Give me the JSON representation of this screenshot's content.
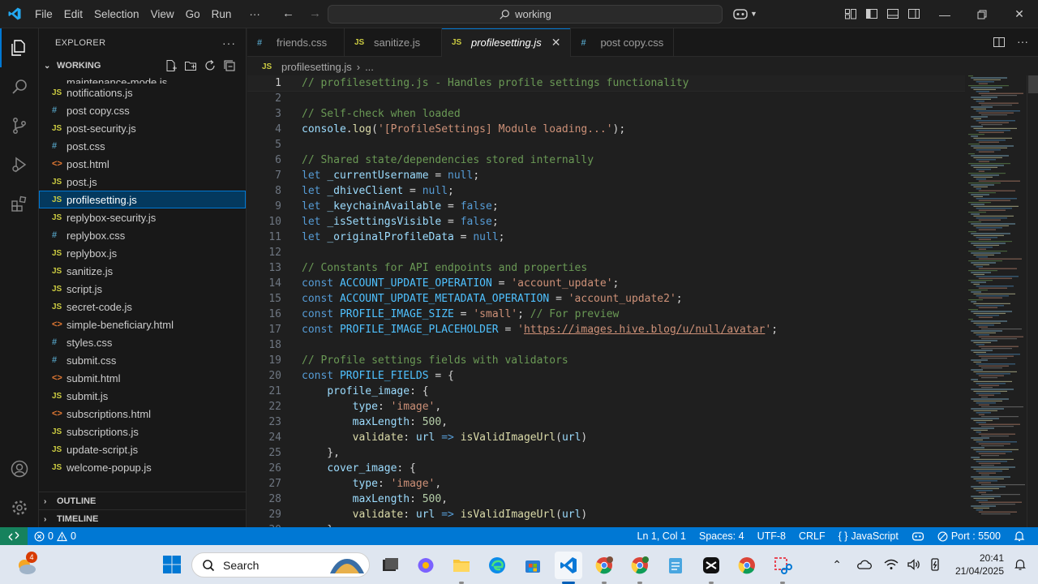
{
  "menu": [
    "File",
    "Edit",
    "Selection",
    "View",
    "Go",
    "Run",
    "···"
  ],
  "command_center": {
    "text": "working"
  },
  "sidebar": {
    "title": "EXPLORER",
    "folder": "WORKING",
    "partial_item": "maintenance-mode.js",
    "files": [
      {
        "name": "notifications.js",
        "type": "js"
      },
      {
        "name": "post copy.css",
        "type": "css"
      },
      {
        "name": "post-security.js",
        "type": "js"
      },
      {
        "name": "post.css",
        "type": "css"
      },
      {
        "name": "post.html",
        "type": "html"
      },
      {
        "name": "post.js",
        "type": "js"
      },
      {
        "name": "profilesetting.js",
        "type": "js",
        "selected": true
      },
      {
        "name": "replybox-security.js",
        "type": "js"
      },
      {
        "name": "replybox.css",
        "type": "css"
      },
      {
        "name": "replybox.js",
        "type": "js"
      },
      {
        "name": "sanitize.js",
        "type": "js"
      },
      {
        "name": "script.js",
        "type": "js"
      },
      {
        "name": "secret-code.js",
        "type": "js"
      },
      {
        "name": "simple-beneficiary.html",
        "type": "html"
      },
      {
        "name": "styles.css",
        "type": "css"
      },
      {
        "name": "submit.css",
        "type": "css"
      },
      {
        "name": "submit.html",
        "type": "html"
      },
      {
        "name": "submit.js",
        "type": "js"
      },
      {
        "name": "subscriptions.html",
        "type": "html"
      },
      {
        "name": "subscriptions.js",
        "type": "js"
      },
      {
        "name": "update-script.js",
        "type": "js"
      },
      {
        "name": "welcome-popup.js",
        "type": "js"
      }
    ],
    "outline_label": "OUTLINE",
    "timeline_label": "TIMELINE"
  },
  "icon_glyphs": {
    "js": "JS",
    "css": "#",
    "html": "<>"
  },
  "tabs": [
    {
      "label": "friends.css",
      "type": "css"
    },
    {
      "label": "sanitize.js",
      "type": "js"
    },
    {
      "label": "profilesetting.js",
      "type": "js",
      "active": true
    },
    {
      "label": "post copy.css",
      "type": "css"
    }
  ],
  "breadcrumb": {
    "file": "profilesetting.js",
    "rest": "..."
  },
  "editor": {
    "lines": [
      [
        [
          "c",
          "// profilesetting.js - Handles profile settings functionality"
        ]
      ],
      [],
      [
        [
          "c",
          "// Self-check when loaded"
        ]
      ],
      [
        [
          "v",
          "console"
        ],
        [
          "p",
          "."
        ],
        [
          "f",
          "log"
        ],
        [
          "p",
          "("
        ],
        [
          "s",
          "'[ProfileSettings] Module loading...'"
        ],
        [
          "p",
          ");"
        ]
      ],
      [],
      [
        [
          "c",
          "// Shared state/dependencies stored internally"
        ]
      ],
      [
        [
          "k",
          "let"
        ],
        [
          "p",
          " "
        ],
        [
          "v",
          "_currentUsername"
        ],
        [
          "p",
          " = "
        ],
        [
          "k",
          "null"
        ],
        [
          "p",
          ";"
        ]
      ],
      [
        [
          "k",
          "let"
        ],
        [
          "p",
          " "
        ],
        [
          "v",
          "_dhiveClient"
        ],
        [
          "p",
          " = "
        ],
        [
          "k",
          "null"
        ],
        [
          "p",
          ";"
        ]
      ],
      [
        [
          "k",
          "let"
        ],
        [
          "p",
          " "
        ],
        [
          "v",
          "_keychainAvailable"
        ],
        [
          "p",
          " = "
        ],
        [
          "k",
          "false"
        ],
        [
          "p",
          ";"
        ]
      ],
      [
        [
          "k",
          "let"
        ],
        [
          "p",
          " "
        ],
        [
          "v",
          "_isSettingsVisible"
        ],
        [
          "p",
          " = "
        ],
        [
          "k",
          "false"
        ],
        [
          "p",
          ";"
        ]
      ],
      [
        [
          "k",
          "let"
        ],
        [
          "p",
          " "
        ],
        [
          "v",
          "_originalProfileData"
        ],
        [
          "p",
          " = "
        ],
        [
          "k",
          "null"
        ],
        [
          "p",
          ";"
        ]
      ],
      [],
      [
        [
          "c",
          "// Constants for API endpoints and properties"
        ]
      ],
      [
        [
          "k",
          "const"
        ],
        [
          "p",
          " "
        ],
        [
          "n",
          "ACCOUNT_UPDATE_OPERATION"
        ],
        [
          "p",
          " = "
        ],
        [
          "s",
          "'account_update'"
        ],
        [
          "p",
          ";"
        ]
      ],
      [
        [
          "k",
          "const"
        ],
        [
          "p",
          " "
        ],
        [
          "n",
          "ACCOUNT_UPDATE_METADATA_OPERATION"
        ],
        [
          "p",
          " = "
        ],
        [
          "s",
          "'account_update2'"
        ],
        [
          "p",
          ";"
        ]
      ],
      [
        [
          "k",
          "const"
        ],
        [
          "p",
          " "
        ],
        [
          "n",
          "PROFILE_IMAGE_SIZE"
        ],
        [
          "p",
          " = "
        ],
        [
          "s",
          "'small'"
        ],
        [
          "p",
          "; "
        ],
        [
          "c",
          "// For preview"
        ]
      ],
      [
        [
          "k",
          "const"
        ],
        [
          "p",
          " "
        ],
        [
          "n",
          "PROFILE_IMAGE_PLACEHOLDER"
        ],
        [
          "p",
          " = "
        ],
        [
          "s",
          "'"
        ],
        [
          "u",
          "https://images.hive.blog/u/null/avatar"
        ],
        [
          "s",
          "'"
        ],
        [
          "p",
          ";"
        ]
      ],
      [],
      [
        [
          "c",
          "// Profile settings fields with validators"
        ]
      ],
      [
        [
          "k",
          "const"
        ],
        [
          "p",
          " "
        ],
        [
          "n",
          "PROFILE_FIELDS"
        ],
        [
          "p",
          " = {"
        ]
      ],
      [
        [
          "p",
          "    "
        ],
        [
          "r",
          "profile_image"
        ],
        [
          "p",
          ": {"
        ]
      ],
      [
        [
          "p",
          "        "
        ],
        [
          "r",
          "type"
        ],
        [
          "p",
          ": "
        ],
        [
          "s",
          "'image'"
        ],
        [
          "p",
          ","
        ]
      ],
      [
        [
          "p",
          "        "
        ],
        [
          "r",
          "maxLength"
        ],
        [
          "p",
          ": "
        ],
        [
          "m",
          "500"
        ],
        [
          "p",
          ","
        ]
      ],
      [
        [
          "p",
          "        "
        ],
        [
          "f",
          "validate"
        ],
        [
          "p",
          ": "
        ],
        [
          "v",
          "url"
        ],
        [
          "p",
          " "
        ],
        [
          "k",
          "=>"
        ],
        [
          "p",
          " "
        ],
        [
          "f",
          "isValidImageUrl"
        ],
        [
          "p",
          "("
        ],
        [
          "v",
          "url"
        ],
        [
          "p",
          ")"
        ]
      ],
      [
        [
          "p",
          "    },"
        ]
      ],
      [
        [
          "p",
          "    "
        ],
        [
          "r",
          "cover_image"
        ],
        [
          "p",
          ": {"
        ]
      ],
      [
        [
          "p",
          "        "
        ],
        [
          "r",
          "type"
        ],
        [
          "p",
          ": "
        ],
        [
          "s",
          "'image'"
        ],
        [
          "p",
          ","
        ]
      ],
      [
        [
          "p",
          "        "
        ],
        [
          "r",
          "maxLength"
        ],
        [
          "p",
          ": "
        ],
        [
          "m",
          "500"
        ],
        [
          "p",
          ","
        ]
      ],
      [
        [
          "p",
          "        "
        ],
        [
          "f",
          "validate"
        ],
        [
          "p",
          ": "
        ],
        [
          "v",
          "url"
        ],
        [
          "p",
          " "
        ],
        [
          "k",
          "=>"
        ],
        [
          "p",
          " "
        ],
        [
          "f",
          "isValidImageUrl"
        ],
        [
          "p",
          "("
        ],
        [
          "v",
          "url"
        ],
        [
          "p",
          ")"
        ]
      ],
      [
        [
          "p",
          "    },"
        ]
      ]
    ]
  },
  "status": {
    "errors": "0",
    "warnings": "0",
    "position": "Ln 1, Col 1",
    "spaces": "Spaces: 4",
    "encoding": "UTF-8",
    "eol": "CRLF",
    "language": "JavaScript",
    "port": "Port : 5500"
  },
  "taskbar": {
    "search_placeholder": "Search",
    "weather_badge": "4",
    "time": "20:41",
    "date": "21/04/2025"
  },
  "colors": {
    "accent": "#0078d4",
    "statusbar": "#0078d4",
    "remote": "#16825d"
  }
}
